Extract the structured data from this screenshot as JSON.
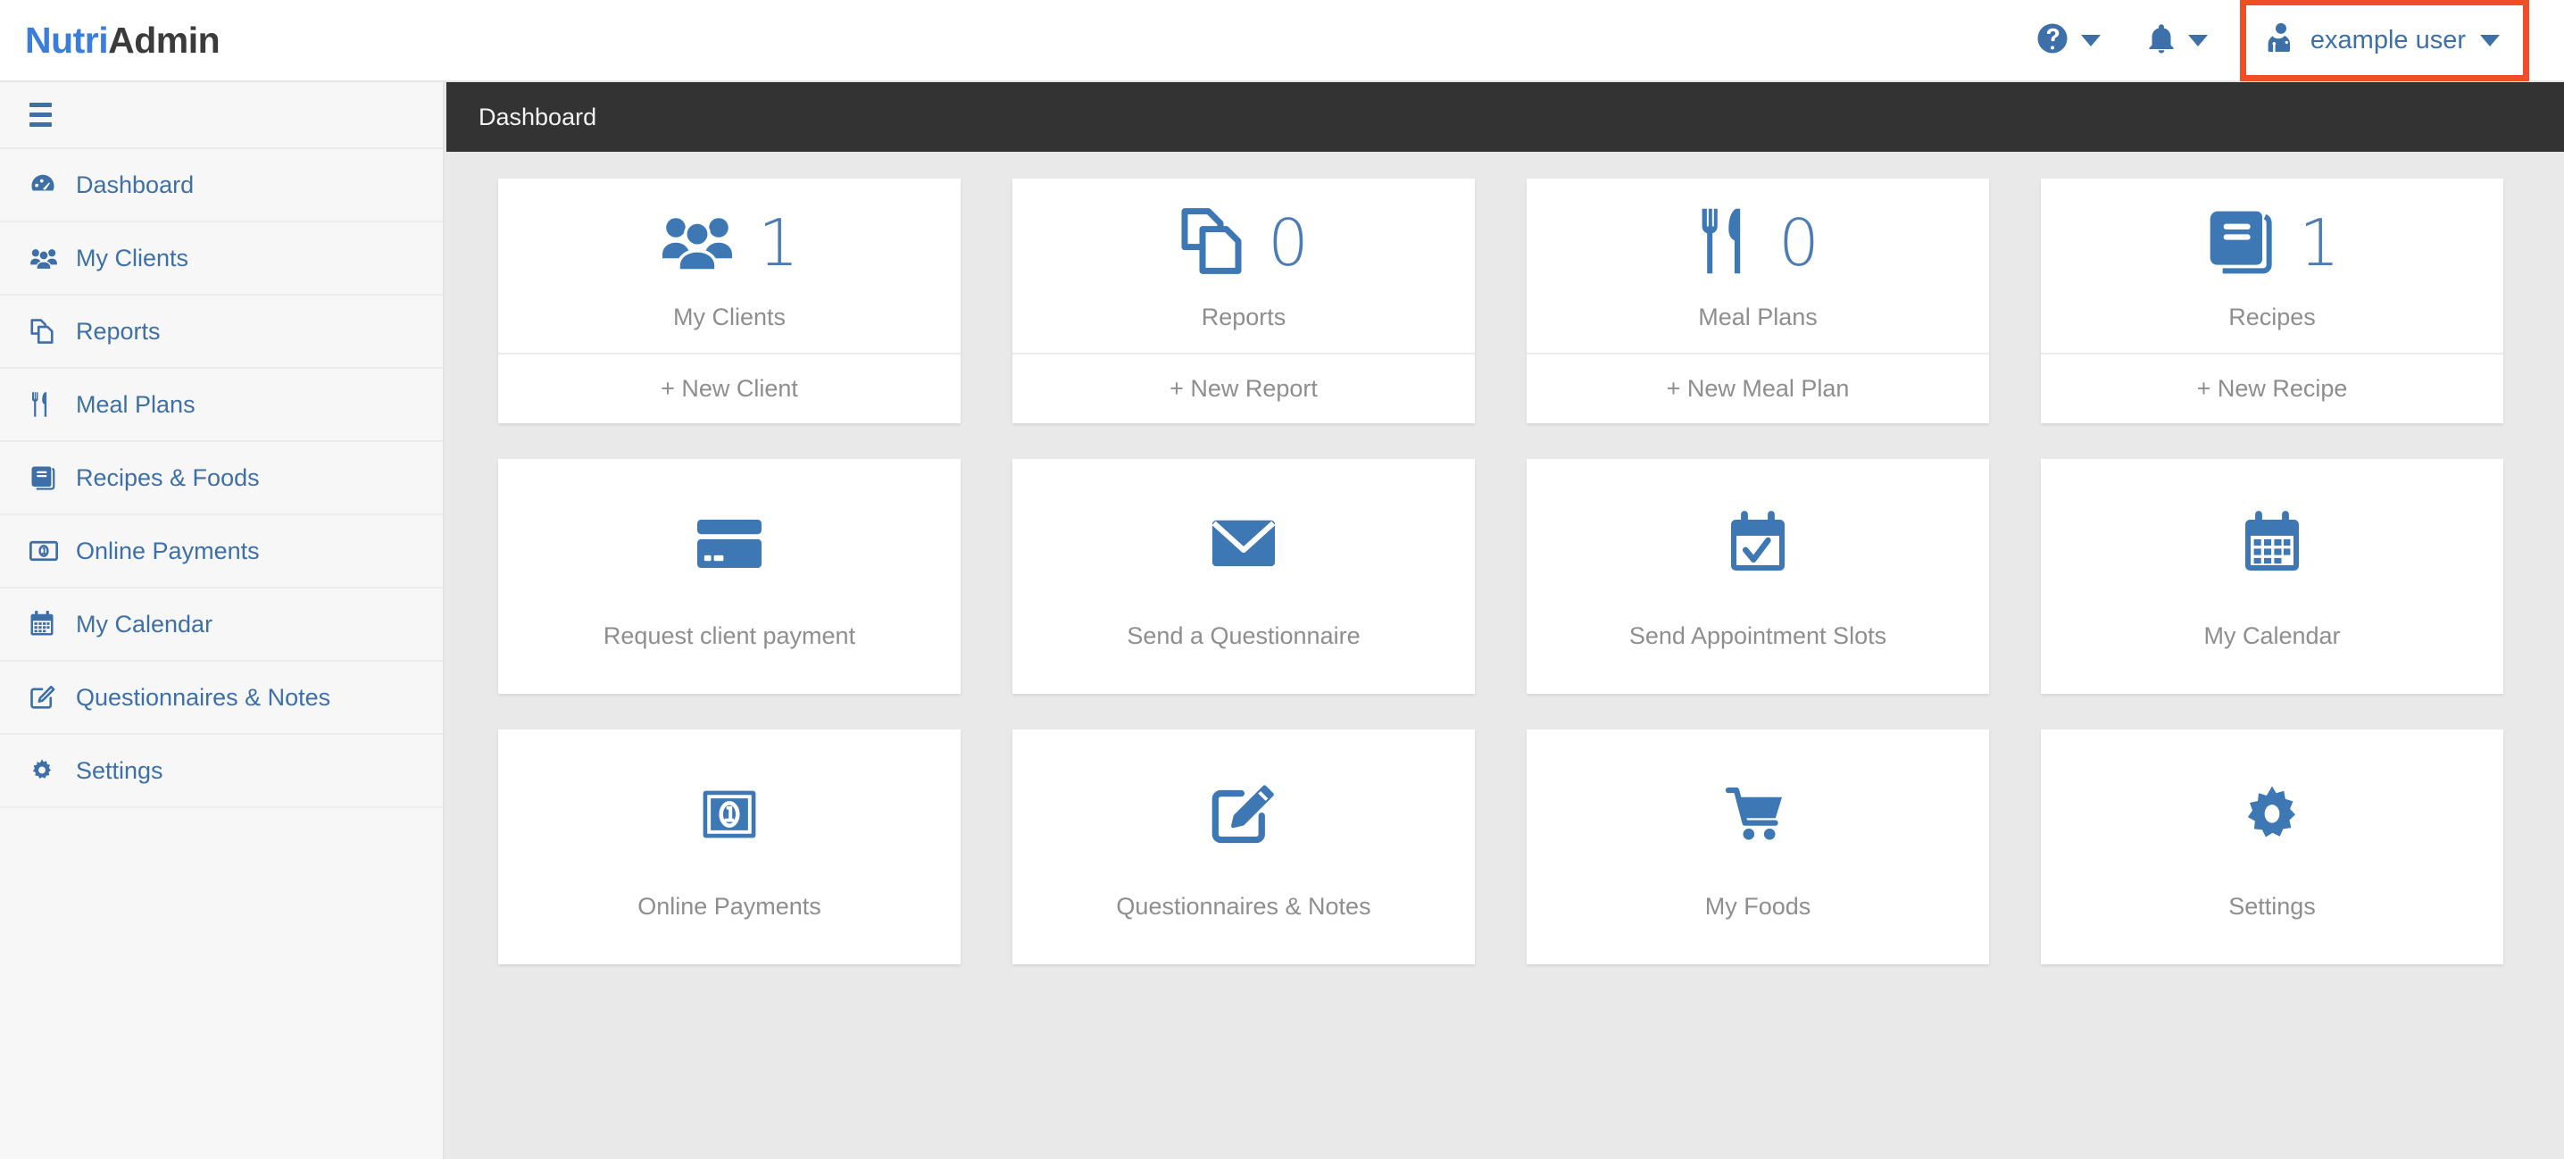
{
  "brand": {
    "part1": "Nutri",
    "part2": "Admin",
    "accent_color": "#3b7ddd"
  },
  "topbar": {
    "help_icon": "question-circle-icon",
    "notifications_icon": "bell-icon",
    "user_icon": "user-md-icon",
    "user_name": "example user",
    "highlight_color": "#f04d28"
  },
  "sidebar": {
    "toggle_icon": "hamburger-icon",
    "items": [
      {
        "label": "Dashboard",
        "icon": "dashboard-icon"
      },
      {
        "label": "My Clients",
        "icon": "users-icon"
      },
      {
        "label": "Reports",
        "icon": "copy-files-icon"
      },
      {
        "label": "Meal Plans",
        "icon": "cutlery-icon"
      },
      {
        "label": "Recipes & Foods",
        "icon": "book-icon"
      },
      {
        "label": "Online Payments",
        "icon": "money-bill-icon"
      },
      {
        "label": "My Calendar",
        "icon": "calendar-icon"
      },
      {
        "label": "Questionnaires & Notes",
        "icon": "pencil-square-icon"
      },
      {
        "label": "Settings",
        "icon": "gear-icon"
      }
    ]
  },
  "breadcrumb": {
    "current": "Dashboard"
  },
  "cards": {
    "row1": [
      {
        "label": "My Clients",
        "count": "1",
        "action": "+ New Client",
        "icon": "users-icon"
      },
      {
        "label": "Reports",
        "count": "0",
        "action": "+ New Report",
        "icon": "copy-files-icon"
      },
      {
        "label": "Meal Plans",
        "count": "0",
        "action": "+ New Meal Plan",
        "icon": "cutlery-icon"
      },
      {
        "label": "Recipes",
        "count": "1",
        "action": "+ New Recipe",
        "icon": "book-icon"
      }
    ],
    "row2": [
      {
        "label": "Request client payment",
        "icon": "credit-card-icon"
      },
      {
        "label": "Send a Questionnaire",
        "icon": "envelope-icon"
      },
      {
        "label": "Send Appointment Slots",
        "icon": "calendar-check-icon"
      },
      {
        "label": "My Calendar",
        "icon": "calendar-icon"
      }
    ],
    "row3": [
      {
        "label": "Online Payments",
        "icon": "money-bill-icon"
      },
      {
        "label": "Questionnaires & Notes",
        "icon": "pencil-square-icon"
      },
      {
        "label": "My Foods",
        "icon": "shopping-cart-icon"
      },
      {
        "label": "Settings",
        "icon": "gear-icon"
      }
    ]
  }
}
